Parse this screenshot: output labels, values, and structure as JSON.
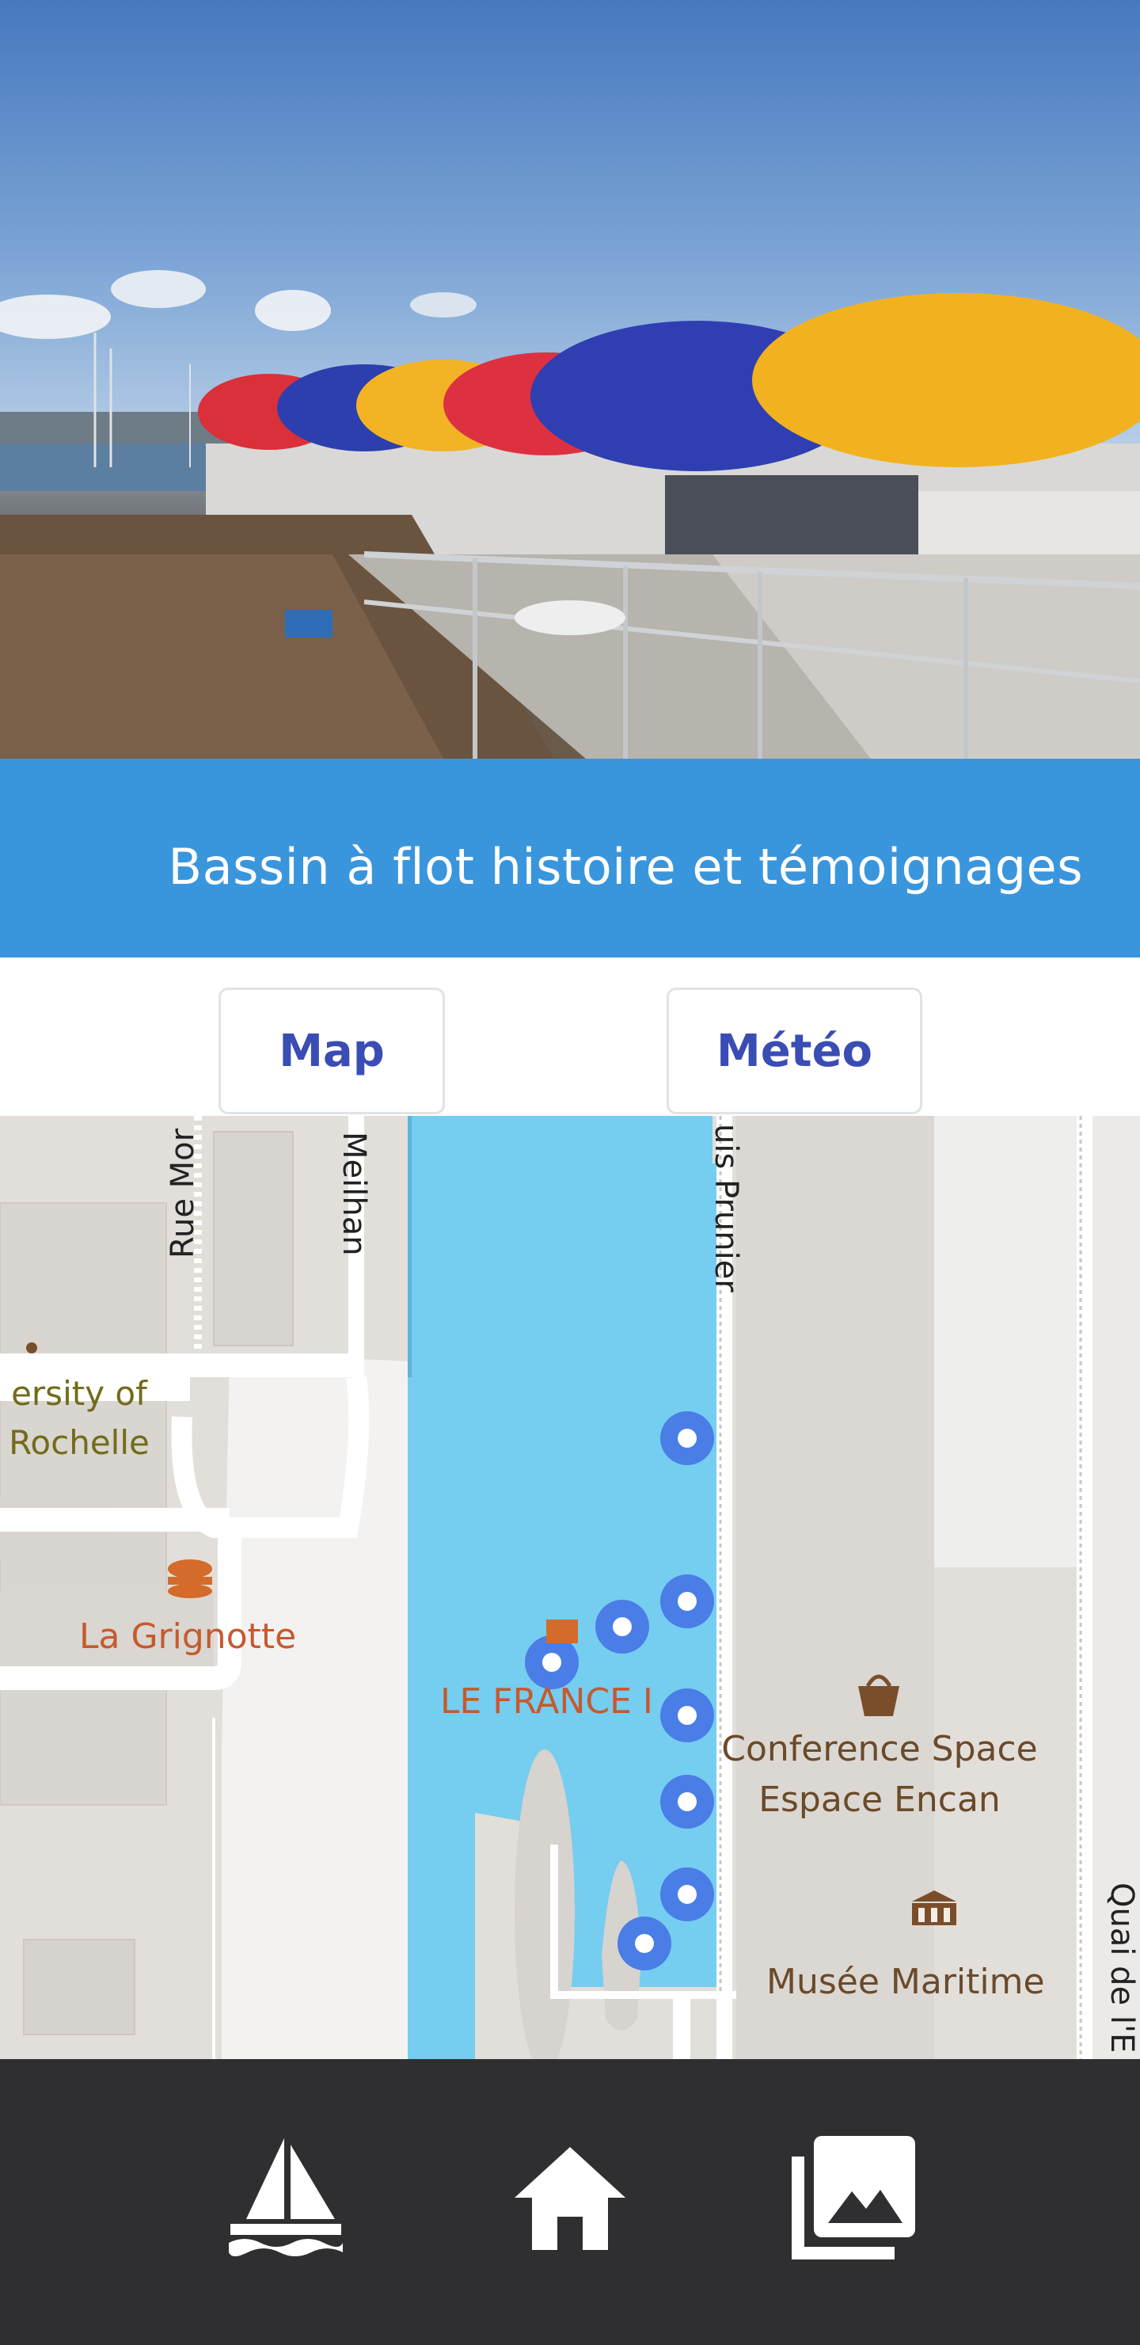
{
  "hero": {
    "image": "colorful-canopies-harbor-photo"
  },
  "title_bar": {
    "title": "Bassin à flot histoire et témoignages",
    "background": "#3a96dc"
  },
  "tabs": [
    {
      "label": "Map"
    },
    {
      "label": "Météo"
    }
  ],
  "map": {
    "streets": [
      "Rue Mor",
      "Meilhan",
      "uis Prunier",
      "Quai de l'E"
    ],
    "places": [
      {
        "name_line1": "ersity of",
        "name_line2": "Rochelle",
        "icon": "university-icon"
      },
      {
        "name": "La Grignotte",
        "icon": "burger-icon"
      },
      {
        "name": "LE FRANCE I",
        "icon": "museum-ship-icon"
      },
      {
        "name_line1": "Conference Space",
        "name_line2": "Espace Encan",
        "icon": "shopping-bag-icon"
      },
      {
        "name": "Musée Maritime",
        "icon": "museum-icon"
      }
    ],
    "marker_icon": "location-pin-icon",
    "colors": {
      "water": "#75cdf0",
      "land": "#e2dfdb",
      "road": "#ffffff",
      "marker": "#4a7de6",
      "poi_orange": "#c55a2e",
      "poi_olive": "#726b1a"
    }
  },
  "bottom_nav": {
    "items": [
      {
        "icon": "sailboat-icon"
      },
      {
        "icon": "home-icon"
      },
      {
        "icon": "photo-library-icon"
      }
    ],
    "background": "#2f2f31"
  }
}
